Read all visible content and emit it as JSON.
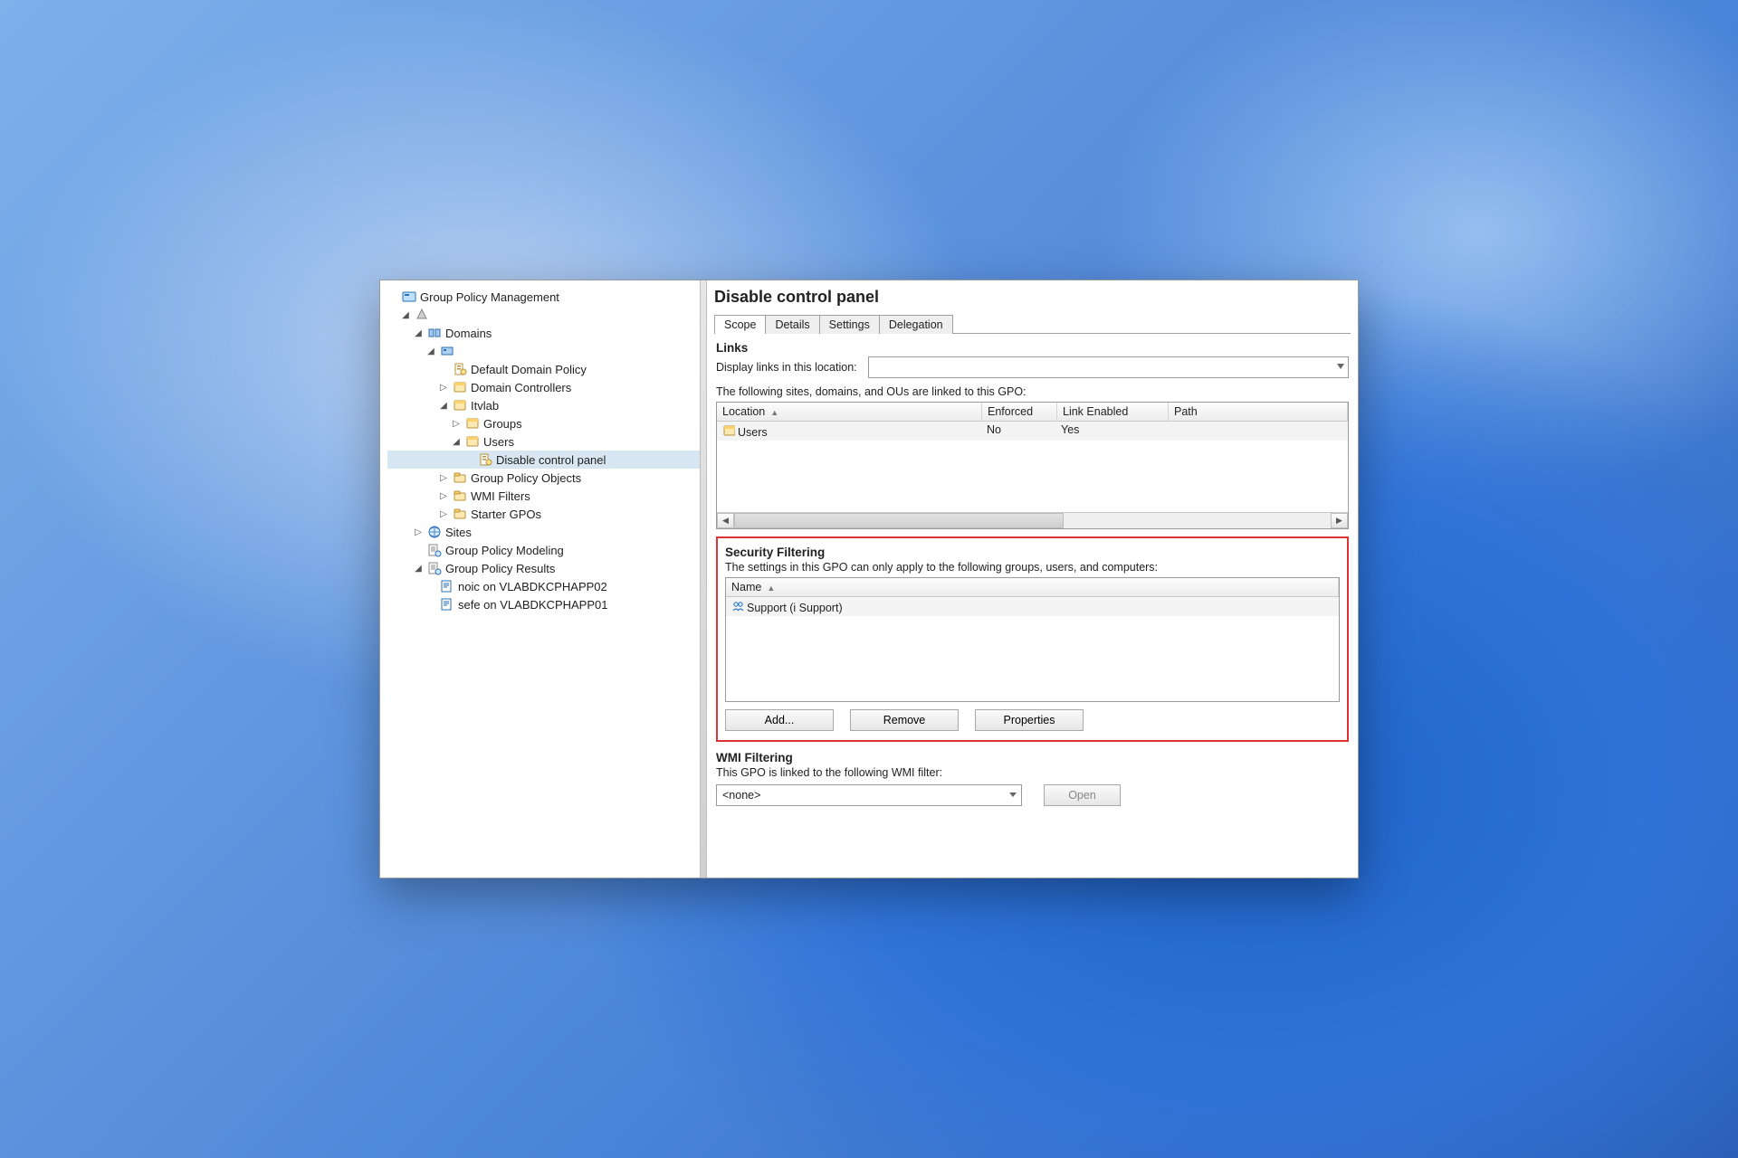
{
  "tree": {
    "root_label": "Group Policy Management",
    "forest_label": "",
    "domains_label": "Domains",
    "domain_label": "",
    "default_domain_policy": "Default Domain Policy",
    "domain_controllers": "Domain Controllers",
    "itvlab": "Itvlab",
    "groups": "Groups",
    "users": "Users",
    "disable_control_panel": "Disable control panel",
    "gpo": "Group Policy Objects",
    "wmi": "WMI Filters",
    "starter": "Starter GPOs",
    "sites": "Sites",
    "modeling": "Group Policy Modeling",
    "results": "Group Policy Results",
    "result1": "noic on VLABDKCPHAPP02",
    "result2": "sefe on VLABDKCPHAPP01"
  },
  "detail": {
    "title": "Disable control panel",
    "tabs": [
      "Scope",
      "Details",
      "Settings",
      "Delegation"
    ],
    "active_tab": "Scope"
  },
  "links": {
    "section": "Links",
    "display_label": "Display links in this location:",
    "hint": "The following sites, domains, and OUs are linked to this GPO:",
    "cols": [
      "Location",
      "Enforced",
      "Link Enabled",
      "Path"
    ],
    "rows": [
      {
        "location": "Users",
        "enforced": "No",
        "enabled": "Yes",
        "path": ""
      }
    ]
  },
  "security": {
    "section": "Security Filtering",
    "hint": "The settings in this GPO can only apply to the following groups, users, and computers:",
    "col": "Name",
    "rows": [
      {
        "name": "Support (i      Support)"
      }
    ],
    "add": "Add...",
    "remove": "Remove",
    "properties": "Properties"
  },
  "wmi": {
    "section": "WMI Filtering",
    "hint": "This GPO is linked to the following WMI filter:",
    "value": "<none>",
    "open": "Open"
  }
}
